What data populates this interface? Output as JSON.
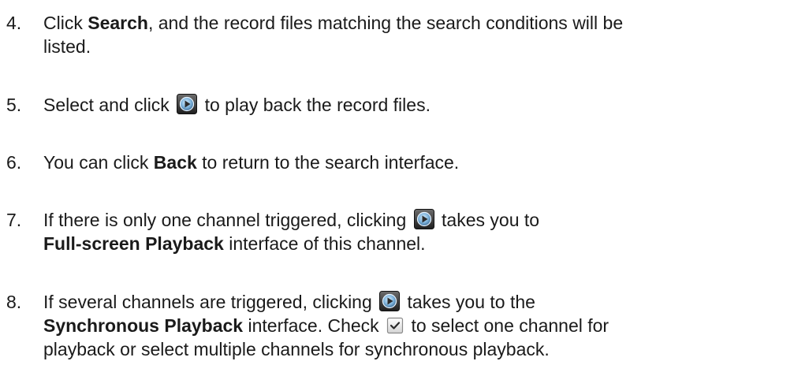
{
  "steps": [
    {
      "number": "4.",
      "lines": [
        {
          "pre": "Click ",
          "bold": "Search",
          "post": ", and the record files matching the search conditions will be"
        },
        {
          "text": "listed."
        }
      ]
    },
    {
      "number": "5.",
      "pre": "Select and click",
      "icon": "play-icon",
      "post": "to play back the record files."
    },
    {
      "number": "6.",
      "pre": "You can click ",
      "bold": "Back",
      "post": " to return to the search interface."
    },
    {
      "number": "7.",
      "line1_pre": "If there is only one channel triggered, clicking",
      "icon": "play-icon",
      "line1_post": "takes you to",
      "line2_bold": "Full-screen Playback",
      "line2_post": " interface of this channel."
    },
    {
      "number": "8.",
      "line1_pre": "If several channels are triggered, clicking",
      "icon": "play-icon",
      "line1_post": "takes you to the",
      "line2_bold": "Synchronous Playback",
      "line2_mid": " interface. Check",
      "check_icon": "checkbox-checked-icon",
      "line2_post": "to select one channel for",
      "line3": "playback or select multiple channels for synchronous playback."
    }
  ]
}
